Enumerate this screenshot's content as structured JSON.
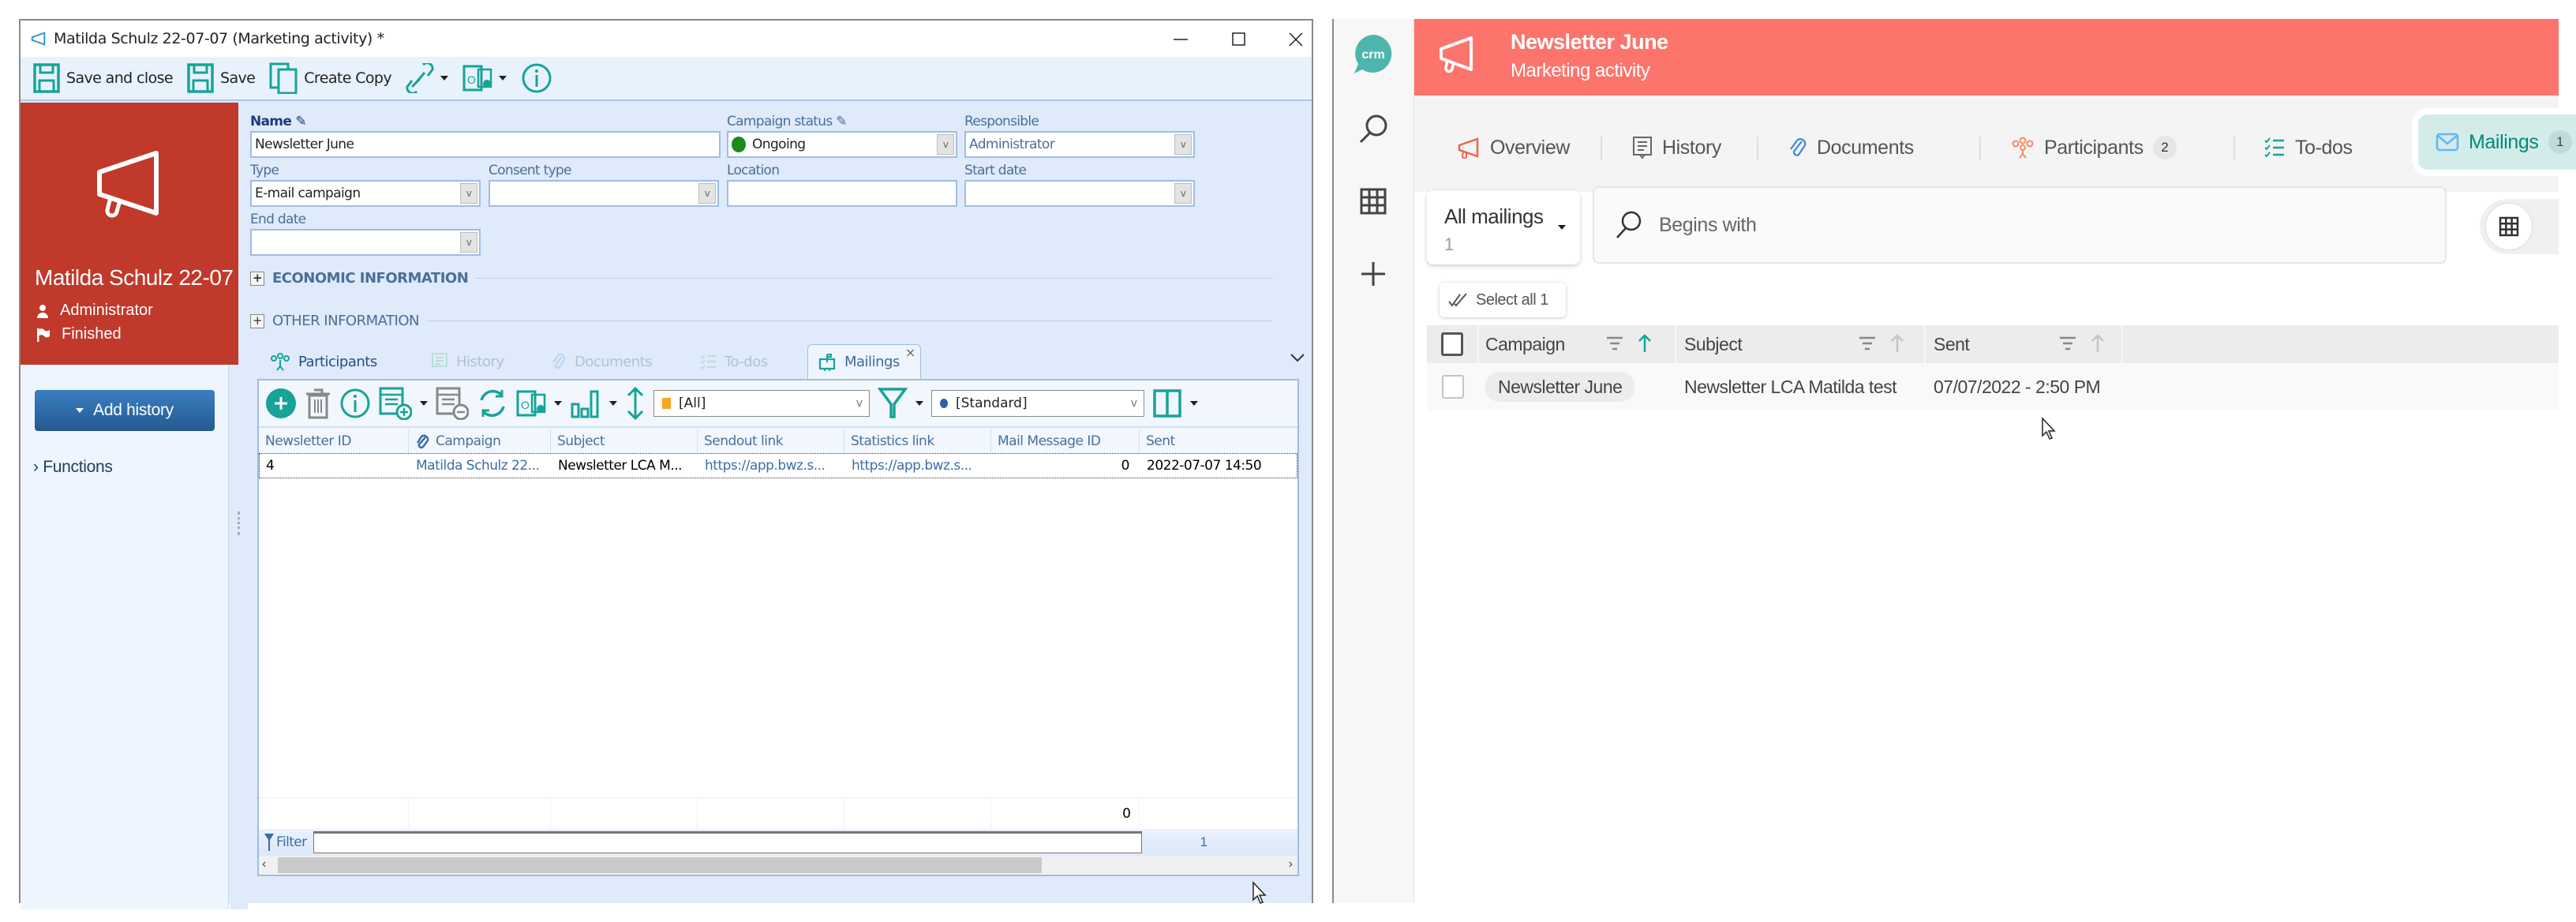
{
  "desktop_window": {
    "title": "Matilda Schulz 22-07-07 (Marketing activity) *",
    "window_controls": [
      "minimize",
      "maximize",
      "close"
    ],
    "toolbar": {
      "save_and_close": "Save and close",
      "save": "Save",
      "create_copy": "Create Copy",
      "link_icon": "link-icon",
      "outlook_icon": "outlook-icon",
      "info_icon": "info-icon"
    },
    "header_card": {
      "icon": "megaphone-icon",
      "title": "Matilda Schulz 22-07",
      "responsible": "Administrator",
      "status": "Finished",
      "color": "#c0392b"
    },
    "sidebar": {
      "add_history": "Add history",
      "functions": "Functions"
    },
    "form": {
      "name_label": "Name",
      "name_value": "Newsletter June",
      "campaign_status_label": "Campaign status",
      "campaign_status_value": "Ongoing",
      "campaign_status_color": "#1a8a1a",
      "responsible_label": "Responsible",
      "responsible_value": "Administrator",
      "type_label": "Type",
      "type_value": "E-mail campaign",
      "consent_type_label": "Consent type",
      "consent_type_value": "",
      "location_label": "Location",
      "location_value": "",
      "start_date_label": "Start date",
      "start_date_value": "",
      "end_date_label": "End date",
      "end_date_value": "",
      "sections": [
        "ECONOMIC INFORMATION",
        "OTHER INFORMATION"
      ]
    },
    "subtabs": [
      {
        "label": "Participants",
        "icon": "participants-icon"
      },
      {
        "label": "History",
        "icon": "history-icon"
      },
      {
        "label": "Documents",
        "icon": "paperclip-icon"
      },
      {
        "label": "To-dos",
        "icon": "todo-icon"
      },
      {
        "label": "Mailings",
        "icon": "mailbox-icon",
        "active": true
      }
    ],
    "grid": {
      "view_filter": "[All]",
      "layout": "[Standard]",
      "columns": [
        "Newsletter ID",
        "Campaign",
        "Subject",
        "Sendout link",
        "Statistics link",
        "Mail Message ID",
        "Sent"
      ],
      "rows": [
        [
          "4",
          "Matilda Schulz 22...",
          "Newsletter LCA M...",
          "https://app.bwz.s...",
          "https://app.bwz.s...",
          "0",
          "2022-07-07 14:50"
        ]
      ],
      "sum_mail_message_id": "0",
      "filter_label": "Filter",
      "filter_value": "",
      "record_count": "1"
    }
  },
  "web_app": {
    "logo_text": "crm",
    "rail": [
      "search-icon",
      "grid-icon",
      "plus-icon"
    ],
    "header": {
      "title": "Newsletter June",
      "subtitle": "Marketing activity",
      "color": "#fd746c"
    },
    "tabs": [
      {
        "label": "Overview",
        "icon": "megaphone-icon"
      },
      {
        "label": "History",
        "icon": "history-icon"
      },
      {
        "label": "Documents",
        "icon": "paperclip-icon"
      },
      {
        "label": "Participants",
        "icon": "participants-icon",
        "badge": "2"
      },
      {
        "label": "To-dos",
        "icon": "todo-icon"
      },
      {
        "label": "Mailings",
        "icon": "mail-icon",
        "badge": "1",
        "active": true
      }
    ],
    "filter_select": {
      "label": "All mailings",
      "count": "1"
    },
    "search": {
      "placeholder": "Begins with",
      "value": ""
    },
    "select_all": "Select all 1",
    "table": {
      "columns": [
        "Campaign",
        "Subject",
        "Sent"
      ],
      "rows": [
        {
          "campaign": "Newsletter June",
          "subject": "Newsletter LCA Matilda test",
          "sent": "07/07/2022 - 2:50 PM"
        }
      ]
    },
    "accent_color": "#00897b"
  }
}
